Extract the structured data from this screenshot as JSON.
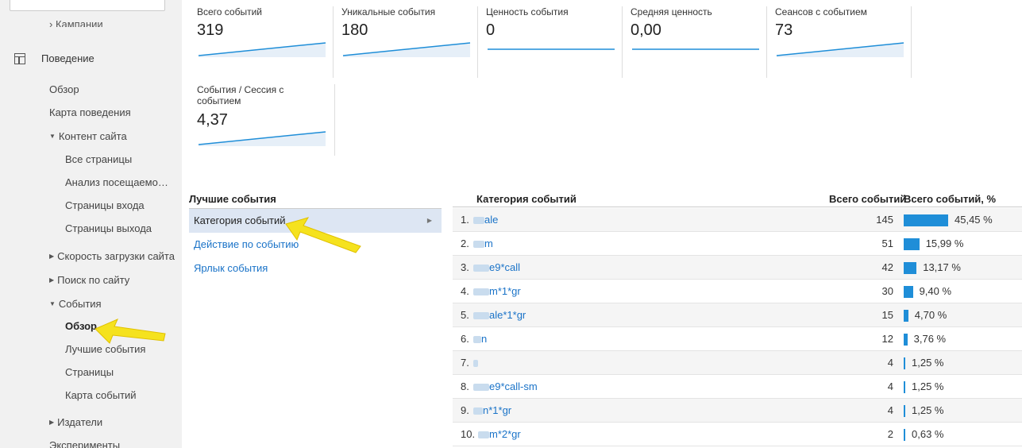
{
  "sidebar": {
    "cut_item": "› Кампании",
    "section": "Поведение",
    "items": [
      {
        "label": "Обзор",
        "caret": ""
      },
      {
        "label": "Карта поведения",
        "caret": ""
      },
      {
        "label": "Контент сайта",
        "caret": "▼"
      },
      {
        "label": "Все страницы",
        "caret": ""
      },
      {
        "label": "Анализ посещаемо…",
        "caret": ""
      },
      {
        "label": "Страницы входа",
        "caret": ""
      },
      {
        "label": "Страницы выхода",
        "caret": ""
      },
      {
        "label": "Скорость загрузки сайта",
        "caret": "▶"
      },
      {
        "label": "Поиск по сайту",
        "caret": "▶"
      },
      {
        "label": "События",
        "caret": "▼"
      },
      {
        "label": "Обзор",
        "caret": ""
      },
      {
        "label": "Лучшие события",
        "caret": ""
      },
      {
        "label": "Страницы",
        "caret": ""
      },
      {
        "label": "Карта событий",
        "caret": ""
      },
      {
        "label": "Издатели",
        "caret": "▶"
      },
      {
        "label": "Эксперименты",
        "caret": ""
      }
    ]
  },
  "metrics": [
    {
      "label": "Всего событий",
      "value": "319",
      "trend": "up"
    },
    {
      "label": "Уникальные события",
      "value": "180",
      "trend": "up"
    },
    {
      "label": "Ценность события",
      "value": "0",
      "trend": "flat"
    },
    {
      "label": "Средняя ценность",
      "value": "0,00",
      "trend": "flat"
    },
    {
      "label": "Сеансов с событием",
      "value": "73",
      "trend": "up"
    },
    {
      "label": "События / Сессия с событием",
      "value": "4,37",
      "trend": "up"
    }
  ],
  "best_events": {
    "title": "Лучшие события",
    "rows": [
      {
        "label": "Категория событий",
        "selected": true
      },
      {
        "label": "Действие по событию",
        "selected": false
      },
      {
        "label": "Ярлык события",
        "selected": false
      }
    ]
  },
  "table": {
    "col_category": "Категория событий",
    "col_total": "Всего событий",
    "col_pct": "Всего событий, %",
    "rows": [
      {
        "num": "1.",
        "category": "ale",
        "total": "145",
        "pct": "45,45 %",
        "pct_value": 45.45
      },
      {
        "num": "2.",
        "category": "m",
        "total": "51",
        "pct": "15,99 %",
        "pct_value": 15.99
      },
      {
        "num": "3.",
        "category": "e9*call",
        "total": "42",
        "pct": "13,17 %",
        "pct_value": 13.17
      },
      {
        "num": "4.",
        "category": "m*1*gr",
        "total": "30",
        "pct": "9,40 %",
        "pct_value": 9.4
      },
      {
        "num": "5.",
        "category": "ale*1*gr",
        "total": "15",
        "pct": "4,70 %",
        "pct_value": 4.7
      },
      {
        "num": "6.",
        "category": "n",
        "total": "12",
        "pct": "3,76 %",
        "pct_value": 3.76
      },
      {
        "num": "7.",
        "category": "",
        "total": "4",
        "pct": "1,25 %",
        "pct_value": 1.25
      },
      {
        "num": "8.",
        "category": "e9*call-sm",
        "total": "4",
        "pct": "1,25 %",
        "pct_value": 1.25
      },
      {
        "num": "9.",
        "category": "n*1*gr",
        "total": "4",
        "pct": "1,25 %",
        "pct_value": 1.25
      },
      {
        "num": "10.",
        "category": "m*2*gr",
        "total": "2",
        "pct": "0,63 %",
        "pct_value": 0.63
      }
    ]
  },
  "colors": {
    "accent": "#1f8ed8",
    "link": "#1a73c8",
    "selected_row": "#dde6f3",
    "arrow": "#f5e21e"
  }
}
